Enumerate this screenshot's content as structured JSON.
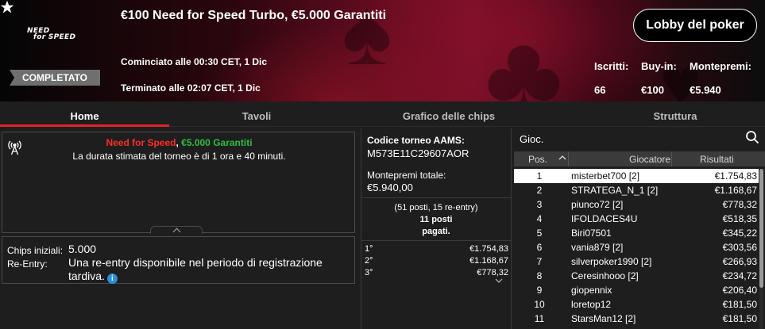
{
  "header": {
    "brand_line1": "NEED",
    "brand_line2": "for SPEED",
    "title": "€100 Need for Speed Turbo, €5.000 Garantiti",
    "status": "COMPLETATO",
    "started": "Cominciato alle 00:30 CET, 1 Dic",
    "ended": "Terminato alle 02:07 CET, 1 Dic",
    "lobby_button": "Lobby del poker",
    "stats": [
      {
        "label": "Iscritti:",
        "value": "66"
      },
      {
        "label": "Buy-in:",
        "value": "€100"
      },
      {
        "label": "Montepremi:",
        "value": "€5.940"
      }
    ]
  },
  "tabs": [
    {
      "label": "Home",
      "active": true
    },
    {
      "label": "Tavoli",
      "active": false
    },
    {
      "label": "Grafico delle chips",
      "active": false
    },
    {
      "label": "Struttura",
      "active": false
    }
  ],
  "info": {
    "headline_red": "Need for Speed",
    "headline_sep": ", ",
    "headline_green": "€5.000 Garantiti",
    "duration": "La durata stimata del torneo è di 1 ora e 40 minuti.",
    "chips_label": "Chips iniziali:",
    "chips_value": "5.000",
    "reentry_label": "Re-Entry:",
    "reentry_value": "Una re-entry disponibile nel periodo di registrazione tardiva.",
    "info_icon": "i"
  },
  "middle": {
    "aams_label": "Codice torneo AAMS:",
    "aams_code": "M573E11C29607AOR",
    "prize_label": "Montepremi totale:",
    "prize_total": "€5.940,00",
    "seats_line1": "(51 posti, 15 re-entry)",
    "seats_line2": "11 posti",
    "seats_line3": "pagati.",
    "payouts": [
      {
        "pos": "1°",
        "amount": "€1.754,83"
      },
      {
        "pos": "2°",
        "amount": "€1.168,67"
      },
      {
        "pos": "3°",
        "amount": "€778,32"
      }
    ]
  },
  "players": {
    "title": "Gioc.",
    "col_pos": "Pos.",
    "col_player": "Giocatore",
    "col_result": "Risultati",
    "rows": [
      {
        "pos": "1",
        "name": "misterbet700 [2]",
        "result": "€1.754,83"
      },
      {
        "pos": "2",
        "name": "STRATEGA_N_1 [2]",
        "result": "€1.168,67"
      },
      {
        "pos": "3",
        "name": "piunco72 [2]",
        "result": "€778,32"
      },
      {
        "pos": "4",
        "name": "IFOLDACES4U",
        "result": "€518,35"
      },
      {
        "pos": "5",
        "name": "Biri07501",
        "result": "€345,22"
      },
      {
        "pos": "6",
        "name": "vania879 [2]",
        "result": "€303,56"
      },
      {
        "pos": "7",
        "name": "silverpoker1990 [2]",
        "result": "€266,93"
      },
      {
        "pos": "8",
        "name": "Ceresinhooo [2]",
        "result": "€234,72"
      },
      {
        "pos": "9",
        "name": "giopennix",
        "result": "€206,40"
      },
      {
        "pos": "10",
        "name": "loretop12",
        "result": "€181,50"
      },
      {
        "pos": "11",
        "name": "StarsMan12 [2]",
        "result": "€181,50"
      }
    ]
  },
  "colors": {
    "accent_red": "#e0232e",
    "headline_red": "#ff2b2b",
    "headline_green": "#2fbd44",
    "info_blue": "#2a8fd6"
  }
}
